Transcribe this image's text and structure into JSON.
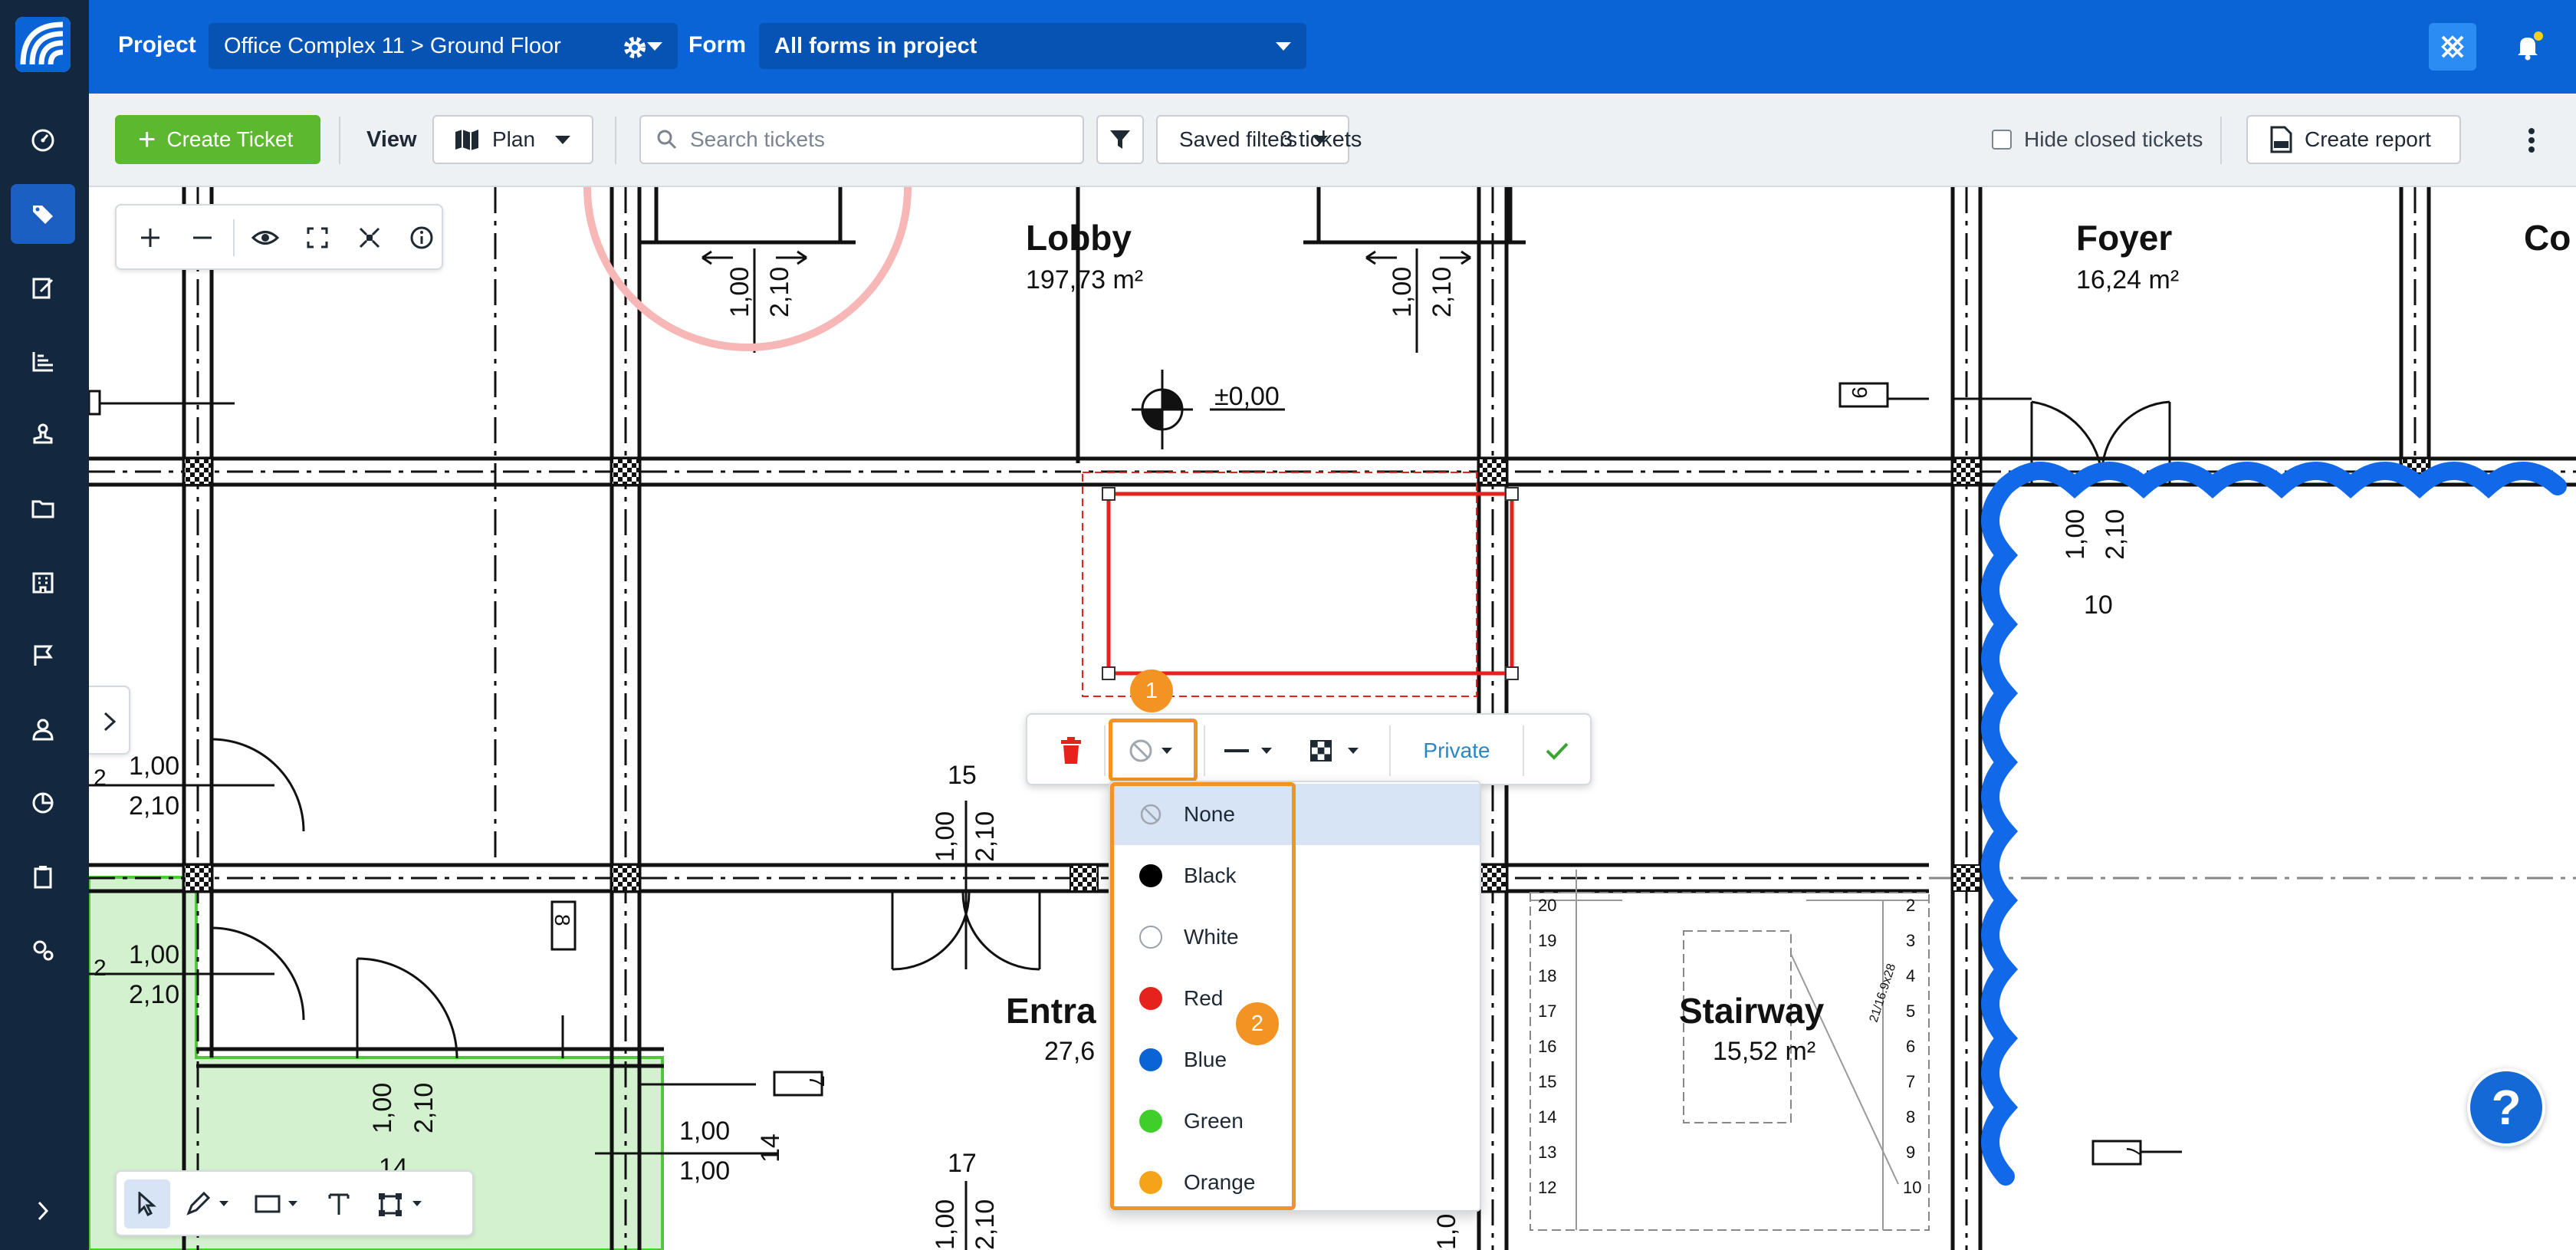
{
  "header": {
    "project_label": "Project",
    "project_value": "Office Complex 11 > Ground Floor",
    "form_label": "Form",
    "form_value": "All forms in project"
  },
  "toolbar": {
    "create_ticket": "Create Ticket",
    "view_label": "View",
    "view_value": "Plan",
    "search_placeholder": "Search tickets",
    "saved_filters": "Saved filters",
    "ticket_count": "3 tickets",
    "hide_closed": "Hide closed tickets",
    "create_report": "Create report"
  },
  "plan": {
    "rooms": [
      {
        "name": "Lobby",
        "area": "197,73 m²"
      },
      {
        "name": "Foyer",
        "area": "16,24 m²"
      },
      {
        "name": "Co",
        "area": ""
      },
      {
        "name": "Entra",
        "area": "27,6"
      },
      {
        "name": "Stairway",
        "area": "15,52 m²"
      }
    ],
    "level_mark": "±0,00",
    "door_dims": [
      "1,00",
      "2,10"
    ],
    "room_numbers": [
      "15",
      "17",
      "14",
      "10",
      "9",
      "8",
      "7",
      "2"
    ],
    "stair_steps_left": [
      "20",
      "19",
      "18",
      "17",
      "16",
      "15",
      "14",
      "13",
      "12"
    ],
    "stair_steps_right": [
      "2",
      "3",
      "4",
      "5",
      "6",
      "7",
      "8",
      "9",
      "10"
    ],
    "stair_note": "21/16.9x28"
  },
  "annotation_toolbar": {
    "privacy_label": "Private"
  },
  "color_menu": {
    "options": [
      {
        "label": "None",
        "color": "none"
      },
      {
        "label": "Black",
        "color": "#000000"
      },
      {
        "label": "White",
        "color": "#ffffff"
      },
      {
        "label": "Red",
        "color": "#e5221c"
      },
      {
        "label": "Blue",
        "color": "#0a64d6"
      },
      {
        "label": "Green",
        "color": "#3fcf2a"
      },
      {
        "label": "Orange",
        "color": "#f5a419"
      }
    ],
    "selected": "None"
  },
  "steps": [
    "1",
    "2"
  ],
  "help": "?",
  "colors": {
    "brand_blue": "#0a64d6",
    "sidebar": "#13283f",
    "create_green": "#5cb82e",
    "step_orange": "#f39323",
    "cloud_blue": "#1169e9",
    "rect_red": "#e5221c"
  }
}
